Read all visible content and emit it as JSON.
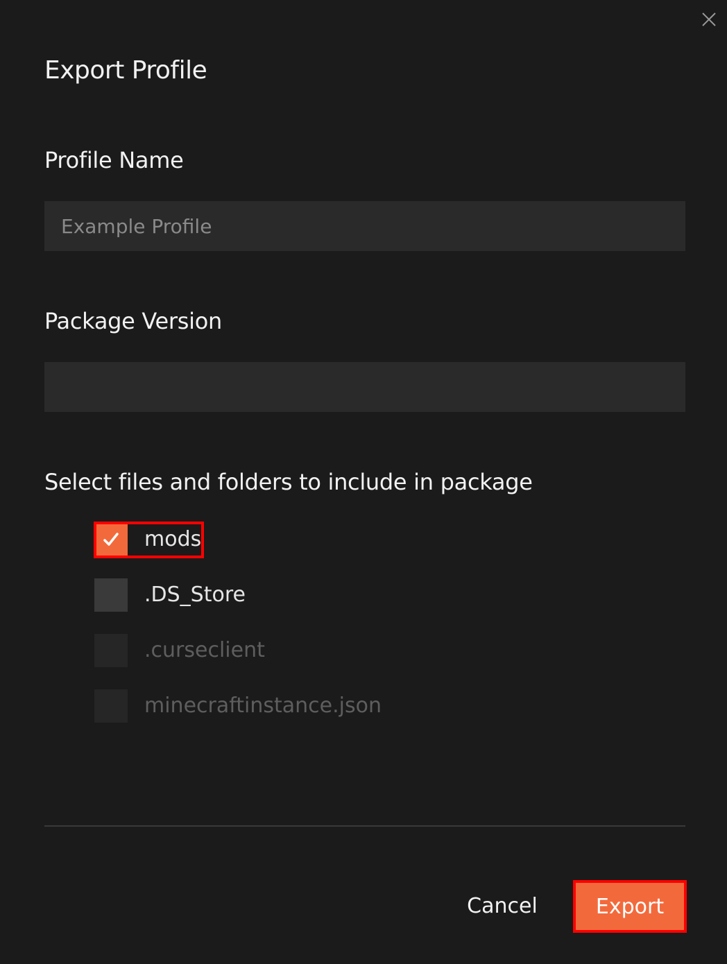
{
  "dialog": {
    "title": "Export Profile",
    "close_icon": "close-icon"
  },
  "profile_name": {
    "label": "Profile Name",
    "placeholder": "Example Profile",
    "value": ""
  },
  "package_version": {
    "label": "Package Version",
    "placeholder": "",
    "value": ""
  },
  "files": {
    "label": "Select files and folders to include in package",
    "items": [
      {
        "name": "mods",
        "checked": true,
        "disabled": false
      },
      {
        "name": ".DS_Store",
        "checked": false,
        "disabled": false
      },
      {
        "name": ".curseclient",
        "checked": false,
        "disabled": true
      },
      {
        "name": "minecraftinstance.json",
        "checked": false,
        "disabled": true
      }
    ]
  },
  "actions": {
    "cancel_label": "Cancel",
    "export_label": "Export"
  },
  "colors": {
    "background": "#1b1b1b",
    "accent": "#f26a3c",
    "input_bg": "#2a2a2a",
    "highlight": "#ff0000"
  }
}
